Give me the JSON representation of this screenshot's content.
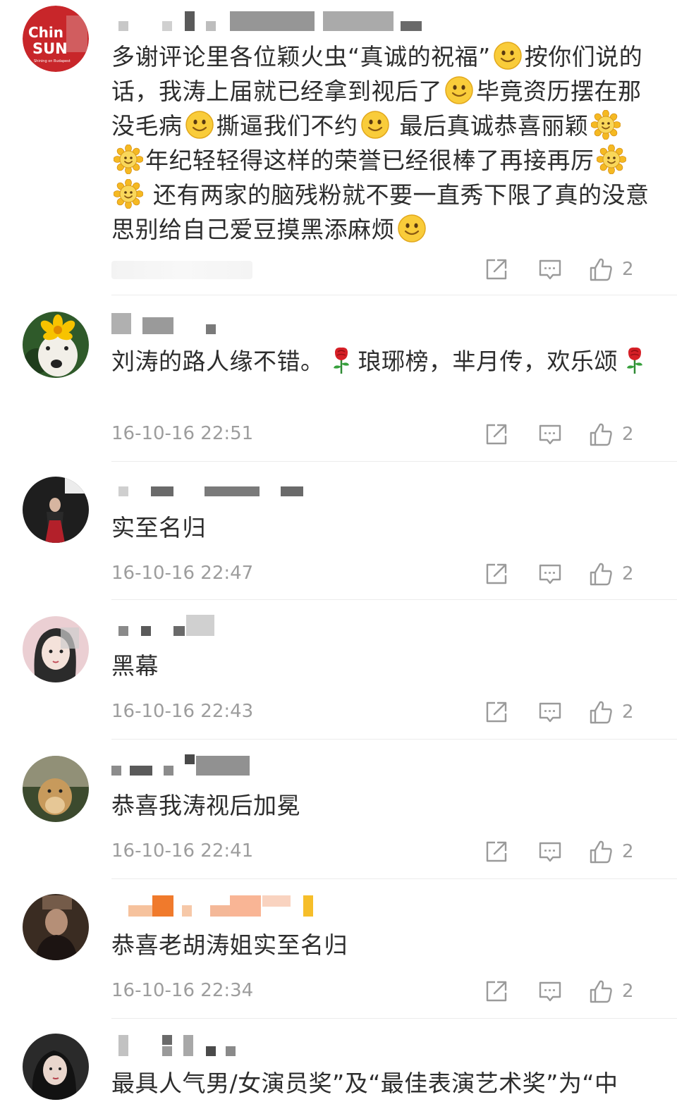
{
  "comments": [
    {
      "username": "",
      "text_segments": [
        "多谢评论里各位颖火虫“真诚的祝福”",
        "按你们说的话，我涛上届就已经拿到视后了",
        "毕竟资历摆在那没毛病",
        "撕逼我们不约",
        " 最后真诚恭喜丽颖",
        "年纪轻轻得这样的荣誉已经很棒了再接再厉",
        " 还有两家的脑残粉就不要一直秀下限了真的没意思别给自己爱豆摸黑添麻烦"
      ],
      "time": "",
      "likes": "2",
      "avatar_text": [
        "Chin",
        "SUN",
        "Shining on Budapest"
      ]
    },
    {
      "username": "",
      "text_segments": [
        "刘涛的路人缘不错。",
        "琅琊榜，芈月传，欢乐颂"
      ],
      "time": "16-10-16 22:51",
      "likes": "2"
    },
    {
      "username": "",
      "text_segments": [
        "实至名归"
      ],
      "time": "16-10-16 22:47",
      "likes": "2"
    },
    {
      "username": "",
      "text_segments": [
        "黑幕"
      ],
      "time": "16-10-16 22:43",
      "likes": "2"
    },
    {
      "username": "",
      "text_segments": [
        "恭喜我涛视后加冕"
      ],
      "time": "16-10-16 22:41",
      "likes": "2"
    },
    {
      "username": "",
      "text_segments": [
        "恭喜老胡涛姐实至名归"
      ],
      "time": "16-10-16 22:34",
      "likes": "2"
    },
    {
      "username": "",
      "text_segments": [
        "最具人气男/女演员奖”及“最佳表演艺术奖”为“中"
      ],
      "time": "",
      "likes": ""
    }
  ],
  "icons": {
    "share": "share-icon",
    "reply": "comment-icon",
    "like": "thumbs-up-icon",
    "smile": "smile-emoji",
    "sunflower": "sunflower-emoji",
    "rose": "rose-emoji"
  },
  "colors": {
    "text": "#2d2d2d",
    "meta": "#9d9d9d",
    "divider": "#ececec",
    "emoji_yellow": "#f7c531",
    "avatar_red": "#c8262a"
  }
}
